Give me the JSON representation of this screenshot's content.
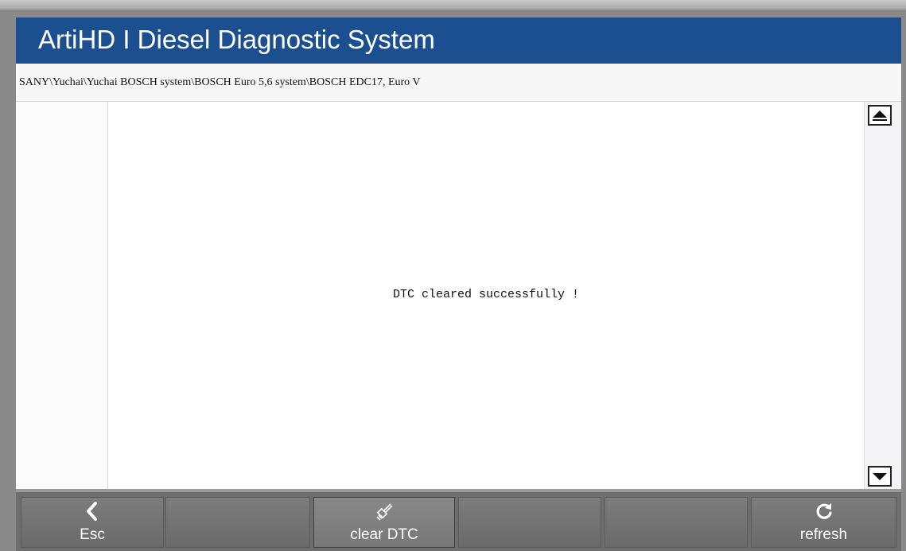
{
  "app": {
    "title": "ArtiHD I Diesel Diagnostic System"
  },
  "breadcrumb": "SANY\\Yuchai\\Yuchai BOSCH system\\BOSCH Euro 5,6 system\\BOSCH EDC17, Euro V",
  "message": "DTC cleared successfully !",
  "colors": {
    "title_bar": "#1b4f8f",
    "toolbar": "#6e6e6e"
  },
  "toolbar": {
    "esc": {
      "label": "Esc",
      "icon": "chevron-left-icon"
    },
    "clear_dtc": {
      "label": "clear DTC",
      "icon": "brush-icon"
    },
    "refresh": {
      "label": "refresh",
      "icon": "refresh-icon"
    }
  }
}
